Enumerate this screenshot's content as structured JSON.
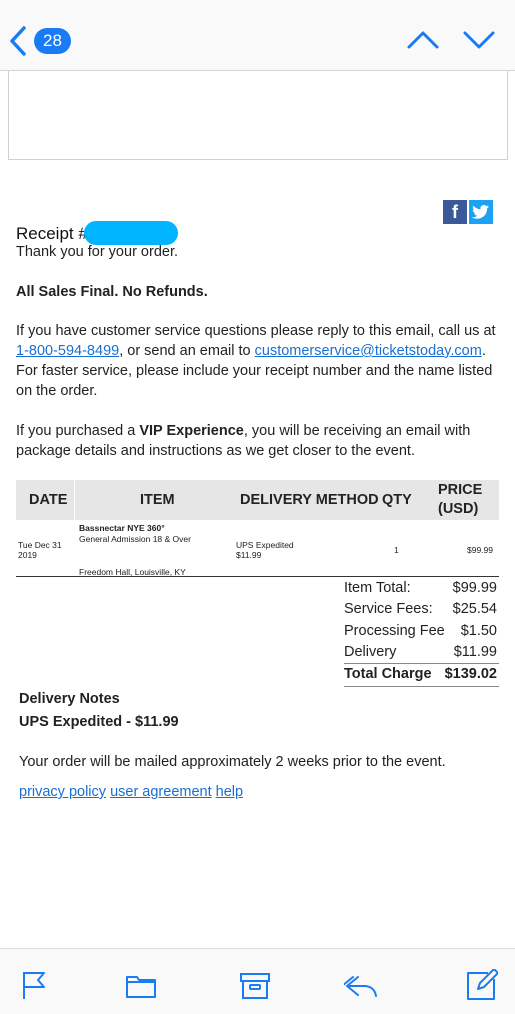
{
  "nav": {
    "unread_count": "28"
  },
  "receipt": {
    "title_prefix": "Receipt #",
    "thanks": "Thank you for your order.",
    "policy": "All Sales Final. No Refunds.",
    "cs_text_1": "If you have customer service questions please reply to this email, call us at",
    "phone": "1-800-594-8499",
    "cs_text_2": ", or send an email to",
    "email": "customerservice@ticketstoday.com",
    "cs_text_3": ".",
    "cs_text_4": "For faster service, please include your receipt number and the name listed on the order.",
    "vip_pre": "If you purchased a",
    "vip_bold": "VIP Experience",
    "vip_post": ", you will be receiving an email with package details and instructions as we get closer to the event."
  },
  "table": {
    "headers": {
      "date": "DATE",
      "item": "ITEM",
      "delivery": "DELIVERY METHOD",
      "qty": "QTY",
      "price_1": "PRICE",
      "price_2": "(USD)"
    },
    "row": {
      "date_1": "Tue Dec 31",
      "date_2": "2019",
      "item_name": "Bassnectar NYE 360°",
      "item_type": "General Admission 18 & Over",
      "venue": "Freedom Hall, Louisville, KY",
      "delivery_1": "UPS Expedited",
      "delivery_2": "$11.99",
      "qty": "1",
      "price": "$99.99"
    }
  },
  "summary": [
    {
      "label": "Item Total:",
      "value": "$99.99"
    },
    {
      "label": "Service Fees:",
      "value": "$25.54"
    },
    {
      "label": "Processing Fee",
      "value": "$1.50"
    },
    {
      "label": "Delivery",
      "value": "$11.99"
    },
    {
      "label": "Total Charge",
      "value": "$139.02"
    }
  ],
  "delivery_notes": {
    "heading": "Delivery Notes",
    "method": "UPS Expedited - $11.99",
    "mailing": "Your order will be mailed approximately 2 weeks prior to the event."
  },
  "footer_links": {
    "privacy": "privacy policy",
    "agreement": "user agreement",
    "help": "help"
  },
  "colors": {
    "accent": "#1a7cf5",
    "redaction": "#00b4ff",
    "facebook": "#3b5998",
    "twitter": "#1da1f2"
  }
}
